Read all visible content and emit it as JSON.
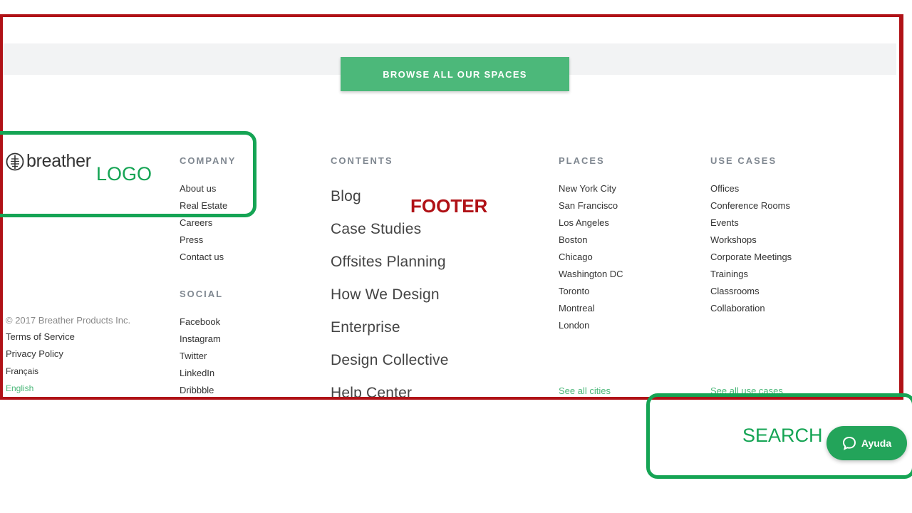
{
  "browse_button": {
    "label": "BROWSE ALL OUR SPACES"
  },
  "logo": {
    "text": "breather"
  },
  "company": {
    "title": "COMPANY",
    "items": [
      "About us",
      "Real Estate",
      "Careers",
      "Press",
      "Contact us"
    ]
  },
  "social": {
    "title": "SOCIAL",
    "items": [
      "Facebook",
      "Instagram",
      "Twitter",
      "LinkedIn",
      "Dribbble"
    ]
  },
  "contents": {
    "title": "CONTENTS",
    "items": [
      "Blog",
      "Case Studies",
      "Offsites Planning",
      "How We Design",
      "Enterprise",
      "Design Collective",
      "Help Center"
    ]
  },
  "places": {
    "title": "PLACES",
    "items": [
      "New York City",
      "San Francisco",
      "Los Angeles",
      "Boston",
      "Chicago",
      "Washington DC",
      "Toronto",
      "Montreal",
      "London"
    ],
    "see_all": "See all cities"
  },
  "use_cases": {
    "title": "USE CASES",
    "items": [
      "Offices",
      "Conference Rooms",
      "Events",
      "Workshops",
      "Corporate Meetings",
      "Trainings",
      "Classrooms",
      "Collaboration"
    ],
    "see_all": "See all use cases"
  },
  "legal": {
    "copyright": "© 2017 Breather Products Inc.",
    "terms": "Terms of Service",
    "privacy": "Privacy Policy",
    "francais": "Français",
    "english": "English"
  },
  "annotations": {
    "logo": "LOGO",
    "footer": "FOOTER",
    "search": "SEARCH"
  },
  "help_button": {
    "label": "Ayuda",
    "icon": "chat-bubble-icon"
  },
  "colors": {
    "annotation_red": "#b01217",
    "annotation_green": "#15a454",
    "brand_green": "#4cb87a",
    "help_green": "#23a45a"
  }
}
